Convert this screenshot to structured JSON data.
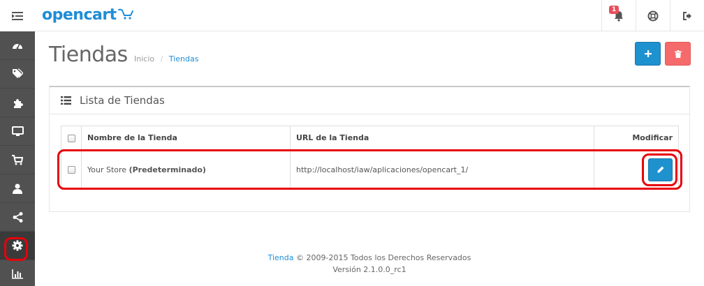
{
  "header": {
    "logo_text": "opencart",
    "notification_count": "1"
  },
  "sidebar": {
    "items": [
      {
        "icon": "dashboard-icon"
      },
      {
        "icon": "tags-icon"
      },
      {
        "icon": "puzzle-icon"
      },
      {
        "icon": "desktop-icon"
      },
      {
        "icon": "shopping-cart-icon"
      },
      {
        "icon": "user-icon"
      },
      {
        "icon": "share-icon"
      },
      {
        "icon": "gear-icon"
      },
      {
        "icon": "bar-chart-icon"
      }
    ]
  },
  "page": {
    "title": "Tiendas",
    "breadcrumb": [
      "Inicio",
      "Tiendas"
    ]
  },
  "panel": {
    "title": "Lista de Tiendas"
  },
  "table": {
    "headers": {
      "name": "Nombre de la Tienda",
      "url": "URL de la Tienda",
      "action": "Modificar"
    },
    "rows": [
      {
        "name": "Your Store",
        "name_suffix": "(Predeterminado)",
        "url": "http://localhost/iaw/aplicaciones/opencart_1/"
      }
    ]
  },
  "footer": {
    "link": "Tienda",
    "copyright": "© 2009-2015 Todos los Derechos Reservados",
    "version": "Versión 2.1.0.0_rc1"
  },
  "colors": {
    "primary": "#1e91cf",
    "danger": "#f56b6b",
    "highlight": "#e8000b",
    "sidebar": "#515151"
  }
}
